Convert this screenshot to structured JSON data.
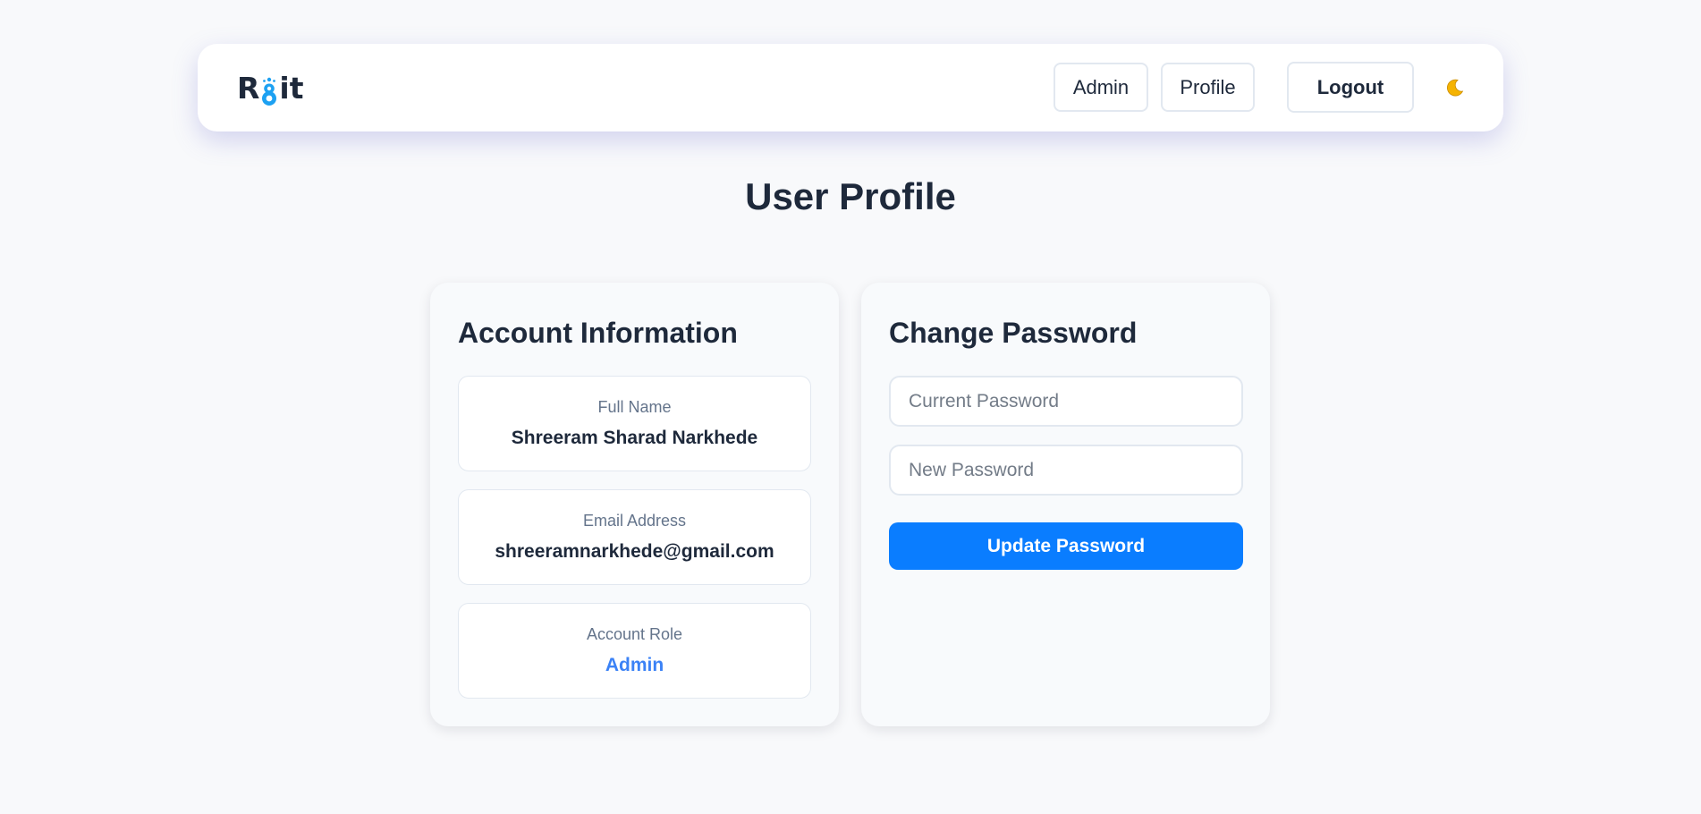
{
  "navbar": {
    "logo_left": "R",
    "logo_right": "it",
    "admin_label": "Admin",
    "profile_label": "Profile",
    "logout_label": "Logout",
    "theme_icon": "moon-icon"
  },
  "page": {
    "title": "User Profile"
  },
  "account": {
    "title": "Account Information",
    "full_name_label": "Full Name",
    "full_name": "Shreeram Sharad Narkhede",
    "email_label": "Email Address",
    "email": "shreeramnarkhede@gmail.com",
    "role_label": "Account Role",
    "role": "Admin"
  },
  "password": {
    "title": "Change Password",
    "current_placeholder": "Current Password",
    "new_placeholder": "New Password",
    "current_value": "",
    "new_value": "",
    "submit_label": "Update Password"
  },
  "colors": {
    "accent": "#0a7dff",
    "role": "#3b82f6",
    "text": "#1e293b",
    "muted": "#64748b",
    "moon": "#f5b301",
    "logo_accent": "#1da1f2"
  }
}
